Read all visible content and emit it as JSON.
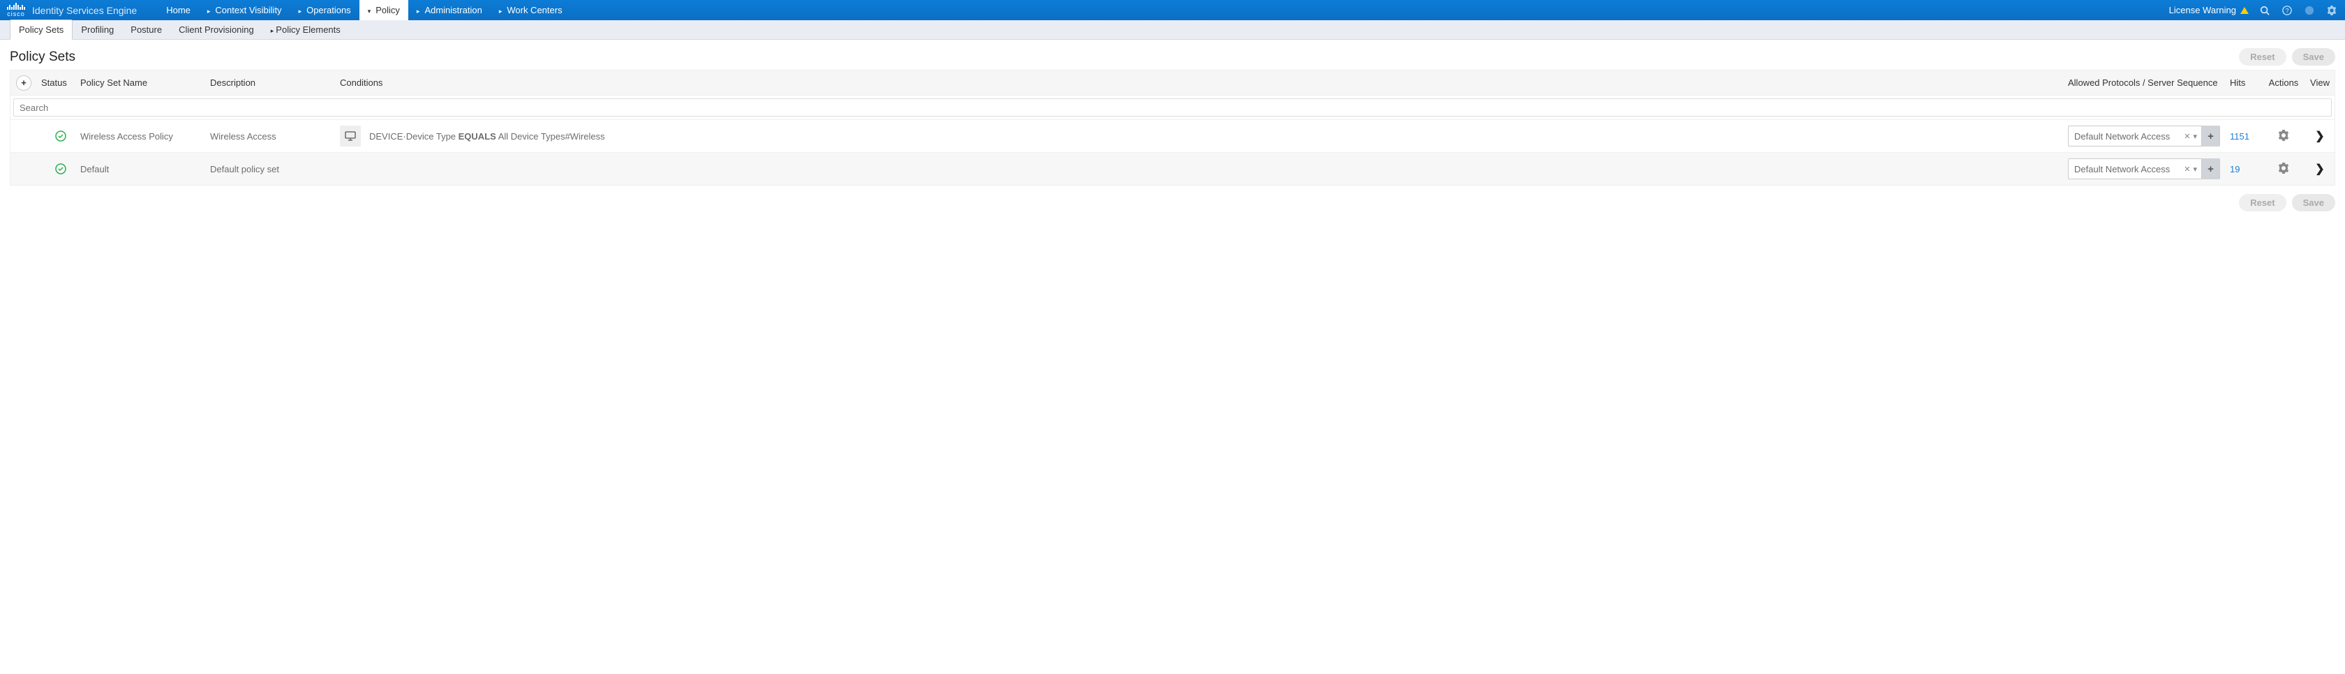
{
  "brand": {
    "logo_text": "cisco",
    "product": "Identity Services Engine"
  },
  "topnav": {
    "home": "Home",
    "context": "Context Visibility",
    "operations": "Operations",
    "policy": "Policy",
    "administration": "Administration",
    "workcenters": "Work Centers"
  },
  "topright": {
    "license_warning": "License Warning"
  },
  "subnav": {
    "policy_sets": "Policy Sets",
    "profiling": "Profiling",
    "posture": "Posture",
    "client_prov": "Client Provisioning",
    "policy_elements": "Policy Elements"
  },
  "page": {
    "title": "Policy Sets"
  },
  "buttons": {
    "reset": "Reset",
    "save": "Save"
  },
  "headers": {
    "status": "Status",
    "name": "Policy Set Name",
    "description": "Description",
    "conditions": "Conditions",
    "protocols": "Allowed Protocols / Server Sequence",
    "hits": "Hits",
    "actions": "Actions",
    "view": "View"
  },
  "search": {
    "placeholder": "Search"
  },
  "rows": [
    {
      "name": "Wireless Access Policy",
      "description": "Wireless Access",
      "cond_prefix": "DEVICE·Device Type ",
      "cond_op": "EQUALS",
      "cond_suffix": " All Device Types#Wireless",
      "protocol": "Default Network Access",
      "hits": "1151"
    },
    {
      "name": "Default",
      "description": "Default policy set",
      "cond_prefix": "",
      "cond_op": "",
      "cond_suffix": "",
      "protocol": "Default Network Access",
      "hits": "19"
    }
  ]
}
